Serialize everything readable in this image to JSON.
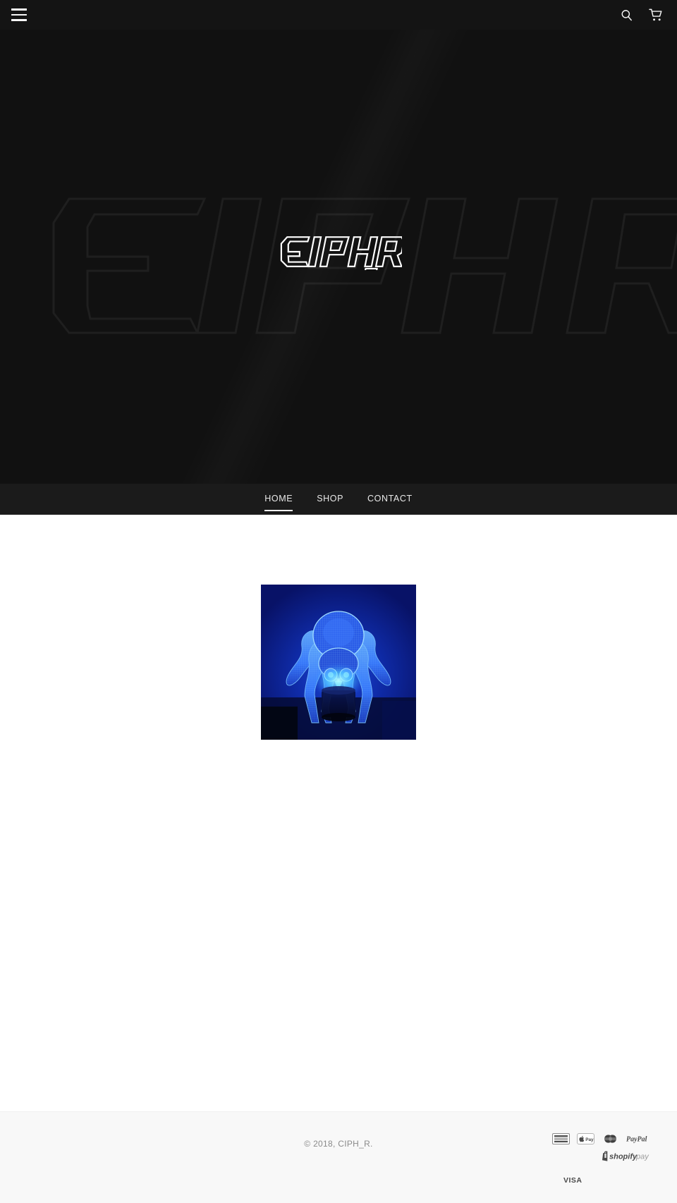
{
  "site": {
    "brand": "CIPH_R",
    "background_color": "#111111",
    "nav_background_color": "#1b1b1b",
    "accent_color": "#ffffff",
    "footer_background_color": "#f8f8f8"
  },
  "topbar": {
    "menu_icon": "hamburger-menu-icon",
    "search_icon": "search-icon",
    "cart_icon": "shopping-cart-icon"
  },
  "hero": {
    "logo_text": "CIPH_R",
    "watermark_text": "CIPH_R"
  },
  "nav": {
    "items": [
      {
        "label": "HOME",
        "active": true
      },
      {
        "label": "SHOP",
        "active": false
      },
      {
        "label": "CONTACT",
        "active": false
      }
    ]
  },
  "main": {
    "products": [
      {
        "image_alt": "3D LED spider night lamp glowing blue",
        "image_colors": {
          "background": "#0c1a75",
          "glow": "#2f6bff",
          "highlight": "#6ff2ff",
          "base": "#050a2e"
        }
      }
    ]
  },
  "footer": {
    "copyright": "© 2018, CIPH_R.",
    "payment_methods": [
      {
        "name": "american-express",
        "label": "AMEX"
      },
      {
        "name": "apple-pay",
        "label": "Apple Pay"
      },
      {
        "name": "master",
        "label": "Mastercard"
      },
      {
        "name": "paypal",
        "label": "PayPal"
      },
      {
        "name": "shopify-pay",
        "label": "shopify pay"
      },
      {
        "name": "visa",
        "label": "VISA"
      }
    ]
  }
}
